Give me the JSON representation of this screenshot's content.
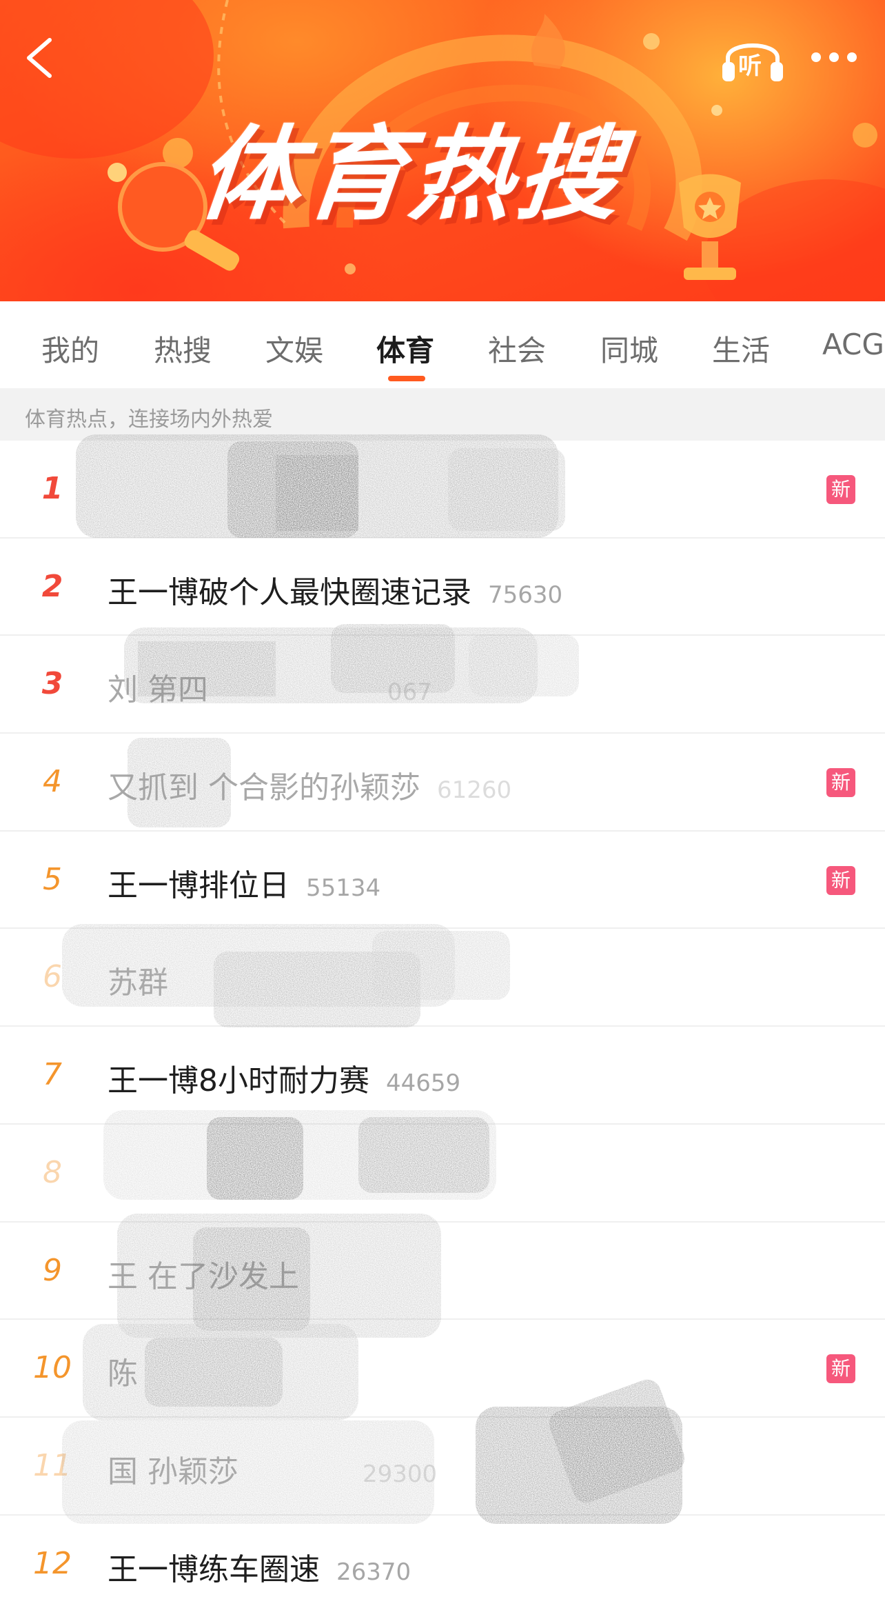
{
  "header": {
    "title": "体育热搜",
    "listen_label": "听"
  },
  "tabs": [
    {
      "label": "我的",
      "active": false
    },
    {
      "label": "热搜",
      "active": false
    },
    {
      "label": "文娱",
      "active": false
    },
    {
      "label": "体育",
      "active": true
    },
    {
      "label": "社会",
      "active": false
    },
    {
      "label": "同城",
      "active": false
    },
    {
      "label": "生活",
      "active": false
    },
    {
      "label": "ACG",
      "active": false
    }
  ],
  "subtitle": "体育热点，连接场内外热爱",
  "list": [
    {
      "rank": "1",
      "title": "",
      "count": "",
      "badge": "新"
    },
    {
      "rank": "2",
      "title": "王一博破个人最快圈速记录",
      "count": "75630",
      "badge": ""
    },
    {
      "rank": "3",
      "title": "刘        第四",
      "count": "067",
      "badge": ""
    },
    {
      "rank": "4",
      "title": "又抓到  个合影的孙颖莎",
      "count": "61260",
      "badge": "新"
    },
    {
      "rank": "5",
      "title": "王一博排位日",
      "count": "55134",
      "badge": "新"
    },
    {
      "rank": "6",
      "title": "苏群        ",
      "count": "",
      "badge": ""
    },
    {
      "rank": "7",
      "title": "王一博8小时耐力赛",
      "count": "44659",
      "badge": ""
    },
    {
      "rank": "8",
      "title": "",
      "count": "",
      "badge": ""
    },
    {
      "rank": "9",
      "title": "王              在了沙发上",
      "count": "",
      "badge": ""
    },
    {
      "rank": "10",
      "title": "陈",
      "count": "",
      "badge": "新"
    },
    {
      "rank": "11",
      "title": "国                 孙颖莎",
      "count": "29300",
      "badge": ""
    },
    {
      "rank": "12",
      "title": "王一博练车圈速",
      "count": "26370",
      "badge": ""
    }
  ],
  "colors": {
    "accent": "#ff5a1f",
    "rank_top": "#f1493a",
    "rank_normal": "#f4952c",
    "badge_new": "#f6587c"
  },
  "icons": {
    "back": "chevron-left-icon",
    "listen": "headphones-icon",
    "more": "ellipsis-icon"
  }
}
